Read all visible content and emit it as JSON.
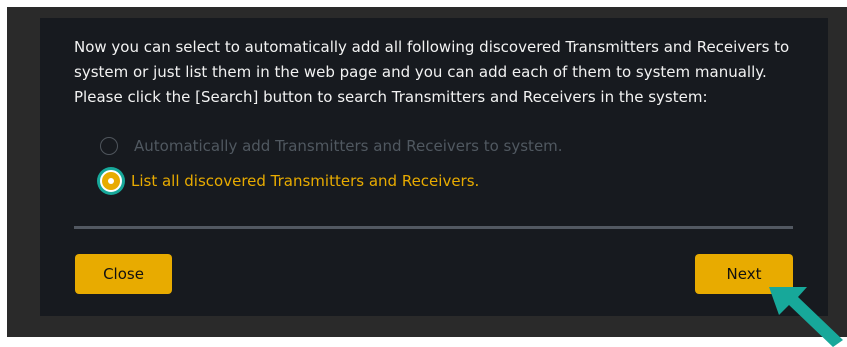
{
  "dialog": {
    "instructions": {
      "line1": "Now you can select to automatically add all following discovered Transmitters and Receivers to system or just list them in the web page and you can add each of them to system manually.",
      "line2": "Please click the [Search] button to search Transmitters and Receivers in the system:"
    },
    "options": {
      "auto_add": "Automatically add Transmitters and Receivers to system.",
      "list_all": "List all discovered Transmitters and Receivers."
    },
    "selected_option": "list_all",
    "buttons": {
      "close": "Close",
      "next": "Next"
    }
  },
  "colors": {
    "accent": "#e8ab00",
    "highlight": "#17a89a",
    "dialog_bg": "#171a1f",
    "disabled_text": "#505860"
  },
  "icons": {
    "pointer": "arrow-pointer-icon"
  }
}
